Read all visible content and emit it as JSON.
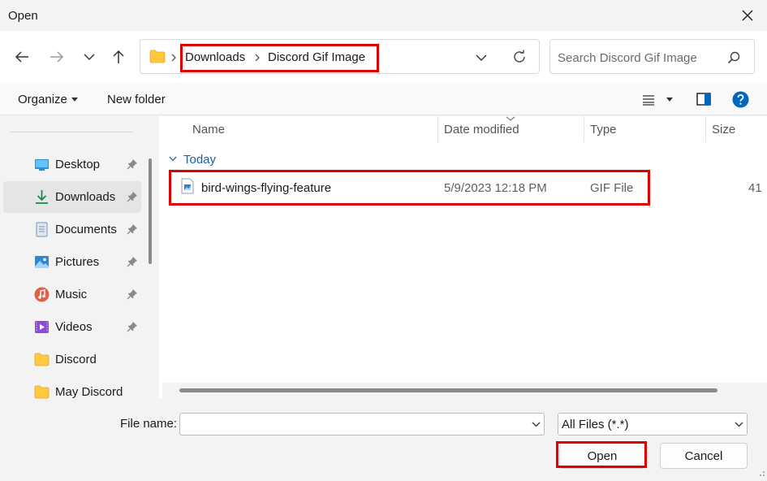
{
  "window": {
    "title": "Open"
  },
  "address_bar": {
    "crumbs": [
      "Downloads",
      "Discord Gif Image"
    ]
  },
  "search": {
    "placeholder": "Search Discord Gif Image"
  },
  "command_bar": {
    "organize_label": "Organize",
    "new_folder_label": "New folder"
  },
  "sidebar": {
    "items": [
      {
        "label": "Desktop",
        "icon": "desktop-icon",
        "pinned": true
      },
      {
        "label": "Downloads",
        "icon": "download-icon",
        "pinned": true,
        "selected": true
      },
      {
        "label": "Documents",
        "icon": "document-icon",
        "pinned": true
      },
      {
        "label": "Pictures",
        "icon": "pictures-icon",
        "pinned": true
      },
      {
        "label": "Music",
        "icon": "music-icon",
        "pinned": true
      },
      {
        "label": "Videos",
        "icon": "videos-icon",
        "pinned": true
      },
      {
        "label": "Discord",
        "icon": "folder-icon",
        "pinned": false
      },
      {
        "label": "May Discord",
        "icon": "folder-icon",
        "pinned": false
      }
    ]
  },
  "file_list": {
    "columns": [
      "Name",
      "Date modified",
      "Type",
      "Size"
    ],
    "group_label": "Today",
    "rows": [
      {
        "name": "bird-wings-flying-feature",
        "date_modified": "5/9/2023 12:18 PM",
        "type": "GIF File",
        "size": "41"
      }
    ]
  },
  "footer": {
    "file_name_label": "File name:",
    "file_name_value": "",
    "file_type_value": "All Files (*.*)",
    "open_label": "Open",
    "cancel_label": "Cancel"
  },
  "colors": {
    "highlight": "#e00000",
    "accent": "#0067c0",
    "folder": "#ffc83d"
  }
}
